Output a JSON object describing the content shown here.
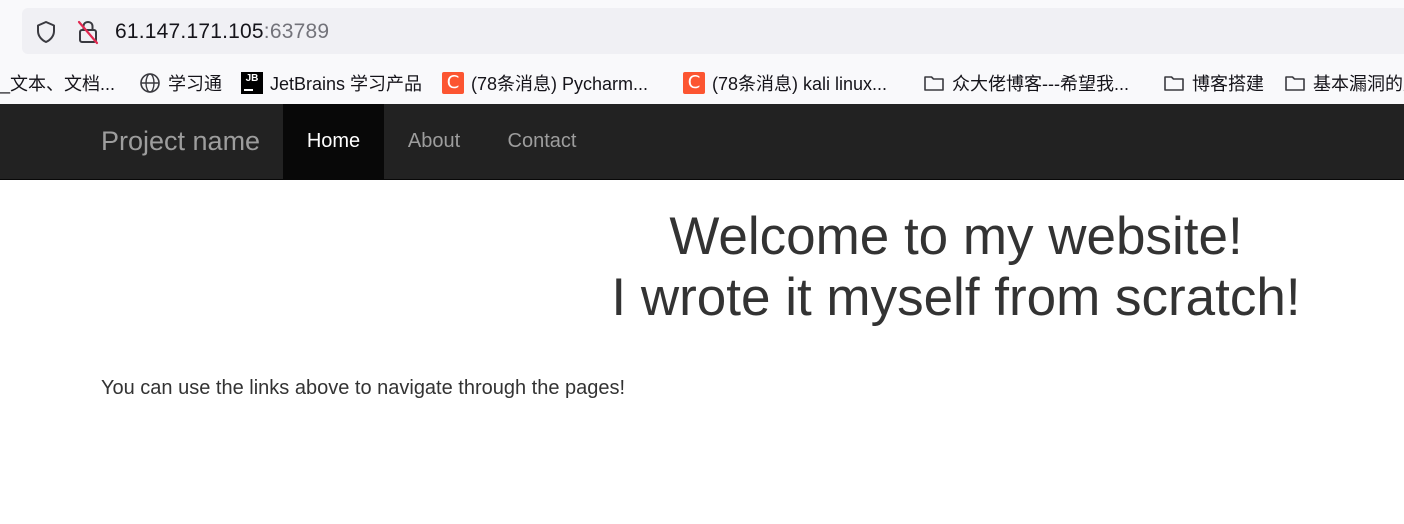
{
  "browser": {
    "url_host": "61.147.171.105",
    "url_port": ":63789",
    "bookmarks": [
      {
        "label": "_文本、文档...",
        "icon": "none"
      },
      {
        "label": "学习通",
        "icon": "globe-icon"
      },
      {
        "label": "JetBrains 学习产品",
        "icon": "jetbrains-icon"
      },
      {
        "label": "(78条消息) Pycharm...",
        "icon": "csdn-icon"
      },
      {
        "label": "(78条消息) kali linux...",
        "icon": "csdn-icon"
      },
      {
        "label": "众大佬博客---希望我...",
        "icon": "folder-icon"
      },
      {
        "label": "博客搭建",
        "icon": "folder-icon"
      },
      {
        "label": "基本漏洞的原",
        "icon": "folder-icon"
      }
    ]
  },
  "navbar": {
    "brand": "Project name",
    "items": [
      {
        "label": "Home",
        "active": true
      },
      {
        "label": "About",
        "active": false
      },
      {
        "label": "Contact",
        "active": false
      }
    ]
  },
  "main": {
    "headline_line1": "Welcome to my website!",
    "headline_line2": "I wrote it myself from scratch!",
    "intro": "You can use the links above to navigate through the pages!"
  },
  "colors": {
    "navbar_bg": "#222222",
    "navbar_active_bg": "#080808",
    "csdn_orange": "#fc5531",
    "text": "#333333"
  }
}
